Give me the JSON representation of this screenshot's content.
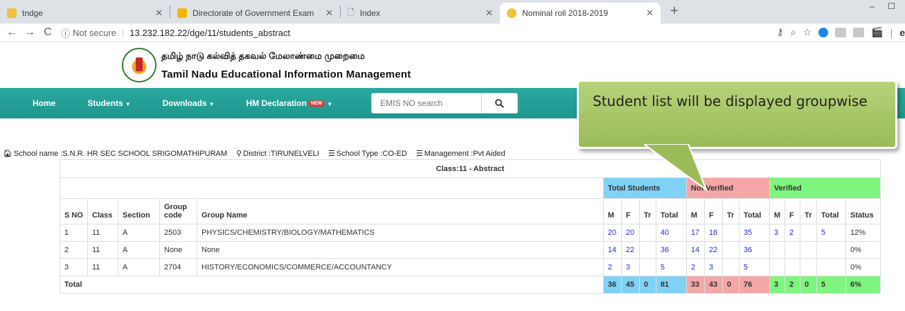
{
  "browser": {
    "tabs": [
      {
        "title": "tndge",
        "color": "#f0c040"
      },
      {
        "title": "Directorate of Government Exam",
        "color": "#f4b400"
      },
      {
        "title": "Index",
        "color": "#9aa0a6"
      },
      {
        "title": "Nominal roll 2018-2019",
        "color": "#f0c040"
      }
    ],
    "url_security": "Not secure",
    "url": "13.232.182.22/dge/11/students_abstract",
    "window_controls": "– ☐"
  },
  "header": {
    "title_ta": "தமிழ் நாடு கல்வித் தகவல் மேலாண்மை முறைமை",
    "title_en": "Tamil Nadu Educational Information Management"
  },
  "nav": {
    "home": "Home",
    "students": "Students",
    "downloads": "Downloads",
    "hm_declaration": "HM Declaration",
    "new_badge": "NEW",
    "search_placeholder": "EMIS NO search"
  },
  "school_info": {
    "name": "School name :S.N.R. HR SEC SCHOOL SRIGOMATHIPURAM",
    "district": "District :TIRUNELVELI",
    "type": "School Type :CO-ED",
    "management": "Management :Pvt Aided"
  },
  "callout": {
    "text": "Student list will be displayed groupwise"
  },
  "table": {
    "title": "Class:11 - Abstract",
    "group_headers": {
      "total": "Total Students",
      "not_verified": "Not Verified",
      "verified": "Verified"
    },
    "columns": {
      "sno": "S NO",
      "class": "Class",
      "section": "Section",
      "group_code": "Group code",
      "group_name": "Group Name",
      "m": "M",
      "f": "F",
      "tr": "Tr",
      "total": "Total",
      "status": "Status"
    },
    "rows": [
      {
        "sno": "1",
        "class": "11",
        "section": "A",
        "code": "2503",
        "name": "PHYSICS/CHEMISTRY/BIOLOGY/MATHEMATICS",
        "tm": "20",
        "tf": "20",
        "ttr": "",
        "tt": "40",
        "nm": "17",
        "nf": "18",
        "ntr": "",
        "nt": "35",
        "vm": "3",
        "vf": "2",
        "vtr": "",
        "vt": "5",
        "status": "12%"
      },
      {
        "sno": "2",
        "class": "11",
        "section": "A",
        "code": "None",
        "name": "None",
        "tm": "14",
        "tf": "22",
        "ttr": "",
        "tt": "36",
        "nm": "14",
        "nf": "22",
        "ntr": "",
        "nt": "36",
        "vm": "",
        "vf": "",
        "vtr": "",
        "vt": "",
        "status": "0%"
      },
      {
        "sno": "3",
        "class": "11",
        "section": "A",
        "code": "2704",
        "name": "HISTORY/ECONOMICS/COMMERCE/ACCOUNTANCY",
        "tm": "2",
        "tf": "3",
        "ttr": "",
        "tt": "5",
        "nm": "2",
        "nf": "3",
        "ntr": "",
        "nt": "5",
        "vm": "",
        "vf": "",
        "vtr": "",
        "vt": "",
        "status": "0%"
      }
    ],
    "totals": {
      "label": "Total",
      "tm": "36",
      "tf": "45",
      "ttr": "0",
      "tt": "81",
      "nm": "33",
      "nf": "43",
      "ntr": "0",
      "nt": "76",
      "vm": "3",
      "vf": "2",
      "vtr": "0",
      "vt": "5",
      "status": "6%"
    }
  }
}
